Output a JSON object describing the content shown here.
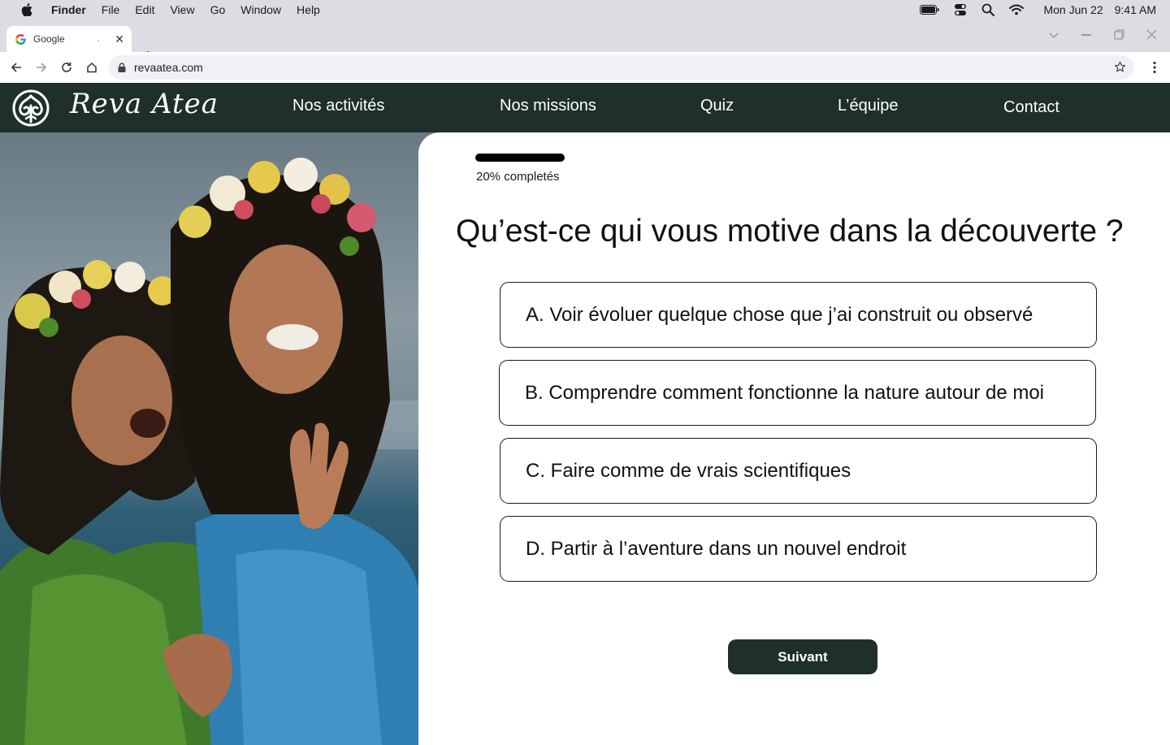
{
  "menubar": {
    "app": "Finder",
    "items": [
      "File",
      "Edit",
      "View",
      "Go",
      "Window",
      "Help"
    ],
    "date": "Mon Jun 22",
    "time": "9:41 AM"
  },
  "browser": {
    "tab_title": "Google",
    "tab_dot": ".",
    "url": "revaatea.com"
  },
  "site": {
    "logo_text": "Reva Atea",
    "nav": [
      "Nos activités",
      "Nos missions",
      "Quiz",
      "L’équipe",
      "Contact"
    ]
  },
  "quiz": {
    "progress_percent": 20,
    "progress_label": "20% completés",
    "question": "Qu’est-ce qui vous motive dans la découverte ?",
    "options": [
      "A. Voir évoluer quelque chose que j’ai construit ou observé",
      "B. Comprendre comment fonctionne la nature autour de moi",
      "C. Faire comme de vrais scientifiques",
      "D. Partir à l’aventure dans un nouvel endroit"
    ],
    "next_label": "Suivant"
  },
  "colors": {
    "header_bg": "#1f2f2b",
    "button_bg": "#1f2f2b",
    "menubar_bg": "#dcdde2"
  }
}
